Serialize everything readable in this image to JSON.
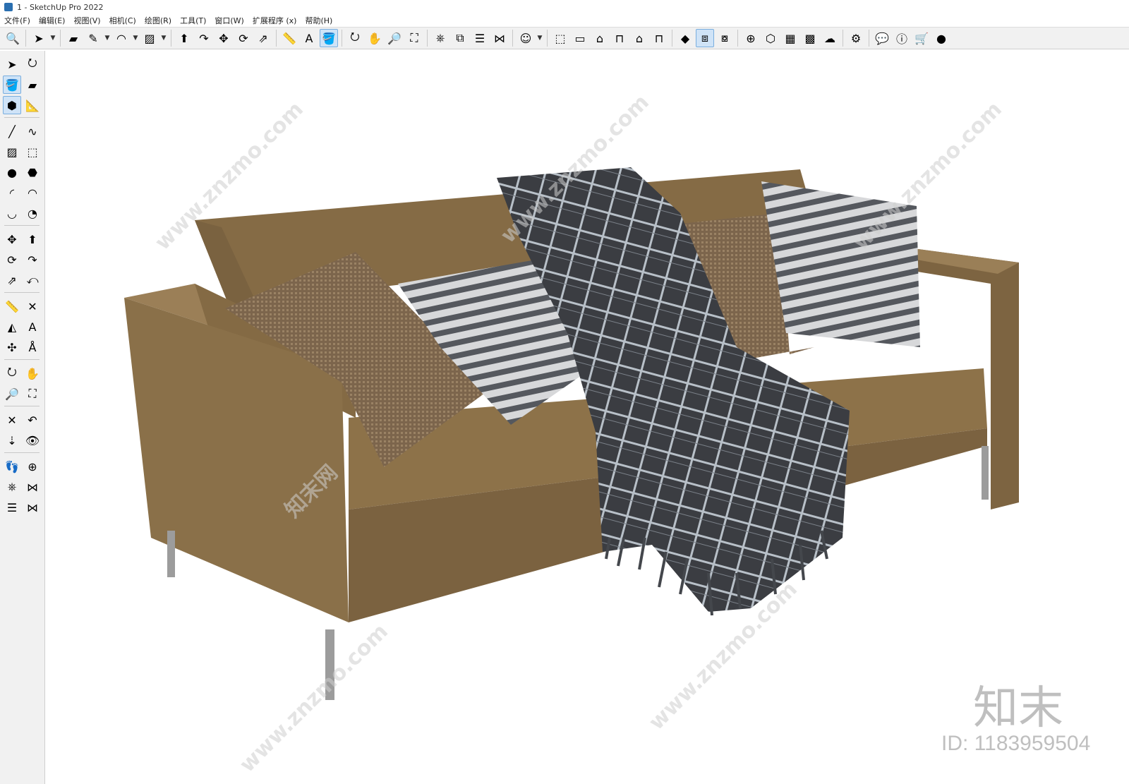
{
  "window": {
    "title": "1 - SketchUp Pro 2022"
  },
  "menu": [
    "文件(F)",
    "编辑(E)",
    "视图(V)",
    "相机(C)",
    "绘图(R)",
    "工具(T)",
    "窗口(W)",
    "扩展程序 (x)",
    "帮助(H)"
  ],
  "toolbar_icons": [
    {
      "name": "zoom-extents-icon",
      "glyph": "🔍"
    },
    {
      "name": "select-icon",
      "glyph": "➤"
    },
    {
      "name": "eraser-icon",
      "glyph": "▰"
    },
    {
      "name": "pencil-icon",
      "glyph": "✎"
    },
    {
      "name": "arc-icon",
      "glyph": "◠"
    },
    {
      "name": "rectangle-icon",
      "glyph": "▨"
    },
    {
      "name": "push-pull-icon",
      "glyph": "⬆"
    },
    {
      "name": "follow-me-icon",
      "glyph": "↷"
    },
    {
      "name": "move-icon",
      "glyph": "✥"
    },
    {
      "name": "rotate-icon",
      "glyph": "⟳"
    },
    {
      "name": "scale-icon",
      "glyph": "⇗"
    },
    {
      "name": "tape-measure-icon",
      "glyph": "📏"
    },
    {
      "name": "text-icon",
      "glyph": "A"
    },
    {
      "name": "paint-bucket-icon",
      "glyph": "🪣"
    },
    {
      "name": "orbit-icon",
      "glyph": "⭮"
    },
    {
      "name": "pan-icon",
      "glyph": "✋"
    },
    {
      "name": "zoom-icon",
      "glyph": "🔎"
    },
    {
      "name": "zoom-window-icon",
      "glyph": "⛶"
    },
    {
      "name": "warehouse-icon",
      "glyph": "⎈"
    },
    {
      "name": "extension-icon",
      "glyph": "⧉"
    },
    {
      "name": "layers-icon",
      "glyph": "☰"
    },
    {
      "name": "sandbox-icon",
      "glyph": "⋈"
    },
    {
      "name": "account-icon",
      "glyph": "☺"
    },
    {
      "name": "iso-view-icon",
      "glyph": "⬚"
    },
    {
      "name": "top-view-icon",
      "glyph": "▭"
    },
    {
      "name": "front-view-icon",
      "glyph": "⌂"
    },
    {
      "name": "right-view-icon",
      "glyph": "⊓"
    },
    {
      "name": "back-view-icon",
      "glyph": "⌂"
    },
    {
      "name": "left-view-icon",
      "glyph": "⊓"
    },
    {
      "name": "solid-tools-icon",
      "glyph": "◆"
    },
    {
      "name": "section-plane-icon",
      "glyph": "⧈"
    },
    {
      "name": "section-display-icon",
      "glyph": "⧇"
    },
    {
      "name": "add-location-icon",
      "glyph": "⊕"
    },
    {
      "name": "shadow-icon",
      "glyph": "⬡"
    },
    {
      "name": "style-icon",
      "glyph": "▦"
    },
    {
      "name": "texture-icon",
      "glyph": "▩"
    },
    {
      "name": "cloud-upload-icon",
      "glyph": "☁"
    },
    {
      "name": "settings-icon",
      "glyph": "⚙"
    },
    {
      "name": "chat-icon",
      "glyph": "💬"
    },
    {
      "name": "info-icon",
      "glyph": "ⓘ"
    },
    {
      "name": "cart-icon",
      "glyph": "🛒"
    },
    {
      "name": "user-icon",
      "glyph": "●"
    }
  ],
  "left_tools": [
    {
      "name": "select-tool-icon",
      "glyph": "➤"
    },
    {
      "name": "orbit-tool-icon",
      "glyph": "⭮"
    },
    {
      "name": "paint-bucket-tool-icon",
      "glyph": "🪣"
    },
    {
      "name": "eraser-tool-icon",
      "glyph": "▰"
    },
    {
      "name": "component-tool-icon",
      "glyph": "⬢"
    },
    {
      "name": "tape-tool-icon",
      "glyph": "📐"
    },
    {
      "name": "line-tool-icon",
      "glyph": "╱"
    },
    {
      "name": "freehand-tool-icon",
      "glyph": "∿"
    },
    {
      "name": "rectangle-tool-icon",
      "glyph": "▨"
    },
    {
      "name": "rotated-rect-tool-icon",
      "glyph": "⬚"
    },
    {
      "name": "circle-tool-icon",
      "glyph": "●"
    },
    {
      "name": "polygon-tool-icon",
      "glyph": "⬣"
    },
    {
      "name": "arc-tool-icon",
      "glyph": "◜"
    },
    {
      "name": "arc-2pt-tool-icon",
      "glyph": "◠"
    },
    {
      "name": "arc-3pt-tool-icon",
      "glyph": "◡"
    },
    {
      "name": "pie-tool-icon",
      "glyph": "◔"
    },
    {
      "name": "move-tool-icon",
      "glyph": "✥"
    },
    {
      "name": "push-pull-tool-icon",
      "glyph": "⬆"
    },
    {
      "name": "rotate-tool-icon",
      "glyph": "⟳"
    },
    {
      "name": "follow-me-tool-icon",
      "glyph": "↷"
    },
    {
      "name": "scale-tool-icon",
      "glyph": "⇗"
    },
    {
      "name": "offset-tool-icon",
      "glyph": "⤺"
    },
    {
      "name": "tape-measure-tool-icon",
      "glyph": "📏"
    },
    {
      "name": "dimension-tool-icon",
      "glyph": "✕"
    },
    {
      "name": "protractor-tool-icon",
      "glyph": "◭"
    },
    {
      "name": "text-tool-icon",
      "glyph": "A"
    },
    {
      "name": "axes-tool-icon",
      "glyph": "✣"
    },
    {
      "name": "3d-text-tool-icon",
      "glyph": "Å"
    },
    {
      "name": "orbit-nav-icon",
      "glyph": "⭮"
    },
    {
      "name": "pan-nav-icon",
      "glyph": "✋"
    },
    {
      "name": "zoom-nav-icon",
      "glyph": "🔎"
    },
    {
      "name": "zoom-window-nav-icon",
      "glyph": "⛶"
    },
    {
      "name": "zoom-extents-nav-icon",
      "glyph": "✕"
    },
    {
      "name": "previous-view-icon",
      "glyph": "↶"
    },
    {
      "name": "position-camera-icon",
      "glyph": "⇣"
    },
    {
      "name": "look-around-icon",
      "glyph": "👁"
    },
    {
      "name": "walk-icon",
      "glyph": "👣"
    },
    {
      "name": "section-plane-tool-icon",
      "glyph": "⊕"
    },
    {
      "name": "warehouse-tool-icon",
      "glyph": "⎈"
    },
    {
      "name": "extension-tool-icon",
      "glyph": "⋈"
    },
    {
      "name": "share-tool-icon",
      "glyph": "☰"
    },
    {
      "name": "sandbox-tool-icon",
      "glyph": "⋈"
    }
  ],
  "watermark_text": "www.znzmo.com",
  "watermark_cn": "知末网",
  "brand": "知末",
  "id_label": "ID: 1183959504",
  "colors": {
    "leather": "#8a7049",
    "leather_dark": "#6e5738",
    "leg": "#9c9c9c",
    "throw": "#3d3f44",
    "pillow_stripe": "#cfd0d2",
    "pillow_brown": "#7c654c"
  }
}
